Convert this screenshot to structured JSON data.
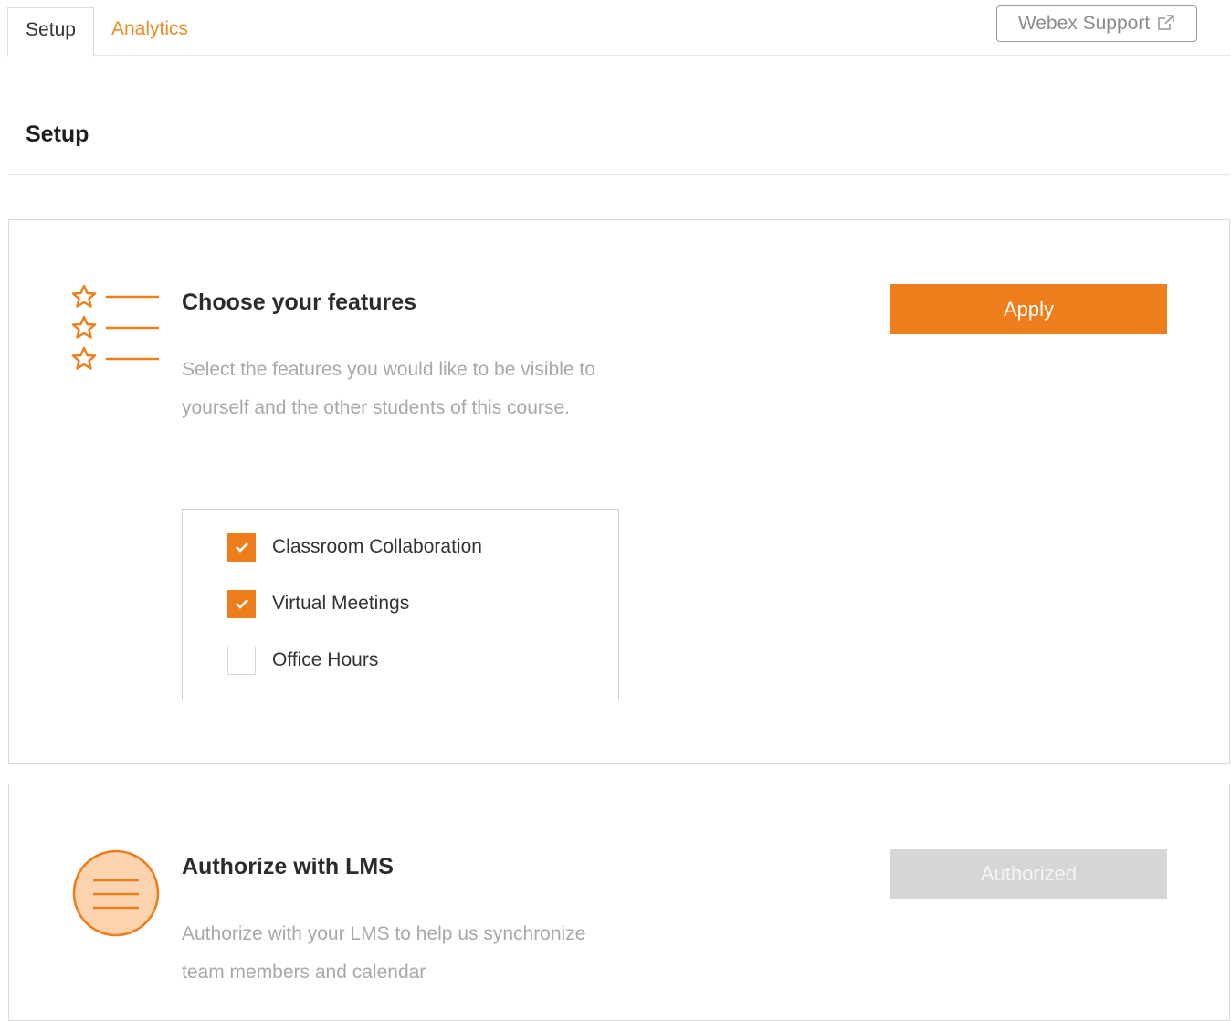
{
  "tabs": [
    {
      "label": "Setup",
      "active": true
    },
    {
      "label": "Analytics",
      "active": false
    }
  ],
  "support_button": {
    "label": "Webex Support",
    "icon": "external-link-icon"
  },
  "page_title": "Setup",
  "features_card": {
    "title": "Choose your features",
    "description": "Select the features you would like to be visible to yourself and the other students of this course.",
    "apply_label": "Apply",
    "icon": "star-list-icon",
    "options": [
      {
        "label": "Classroom Collaboration",
        "checked": true
      },
      {
        "label": "Virtual Meetings",
        "checked": true
      },
      {
        "label": "Office Hours",
        "checked": false
      }
    ]
  },
  "lms_card": {
    "title": "Authorize with LMS",
    "description": "Authorize with your LMS to help us synchronize team members and calendar",
    "button_label": "Authorized",
    "icon": "menu-circle-icon"
  },
  "colors": {
    "accent": "#ed7e1b",
    "tab_link": "#ed8b25",
    "disabled": "#d6d6d6"
  }
}
